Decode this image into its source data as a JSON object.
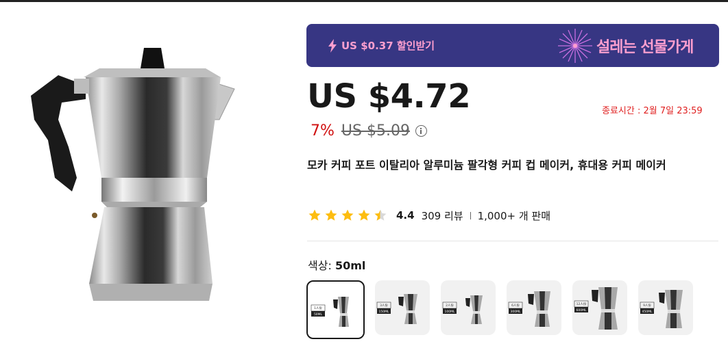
{
  "banner": {
    "discount_text": "US $0.37 할인받기",
    "brand_text": "설레는 선물가게",
    "colors": {
      "background": "#373683",
      "text": "#ff9fcf"
    }
  },
  "price": {
    "current": "US $4.72",
    "discount_percent": "7%",
    "original": "US $5.09",
    "end_time": "종료시간 : 2월 7일 23:59"
  },
  "product": {
    "title": "모카 커피 포트 이탈리아 알루미늄 팔각형 커피 컵 메이커, 휴대용 커피 메이커"
  },
  "rating": {
    "stars": 4.4,
    "value": "4.4",
    "reviews": "309 리뷰",
    "sold": "1,000+ 개 판매"
  },
  "color": {
    "label": "색상:",
    "selected": "50ml",
    "options": [
      {
        "badge": "1人份",
        "size": "50ML",
        "selected": true
      },
      {
        "badge": "3人份",
        "size": "150ML",
        "selected": false
      },
      {
        "badge": "2人份",
        "size": "100ML",
        "selected": false
      },
      {
        "badge": "6人份",
        "size": "300ML",
        "selected": false
      },
      {
        "badge": "12人份",
        "size": "600ML",
        "selected": false
      },
      {
        "badge": "9人份",
        "size": "450ML",
        "selected": false
      }
    ]
  },
  "icons": [
    "lightning-icon",
    "fireworks-icon",
    "info-icon",
    "star-icon",
    "half-star-icon"
  ]
}
